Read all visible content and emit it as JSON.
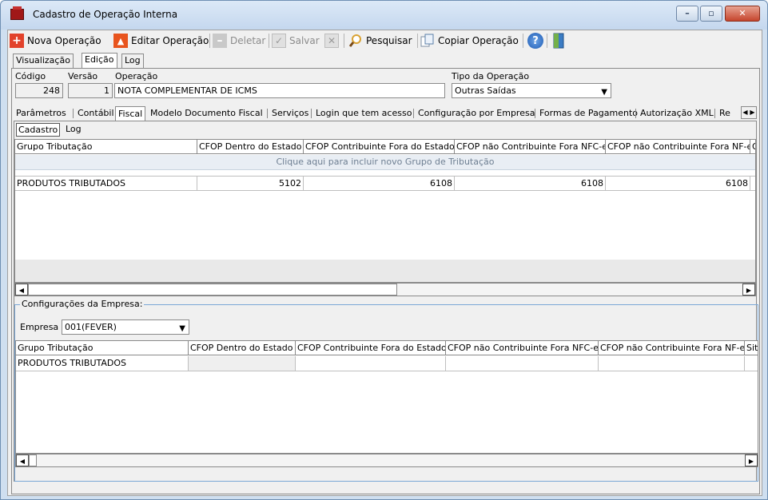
{
  "window": {
    "title": "Cadastro de Operação Interna",
    "minimize": "–",
    "maximize": "▫",
    "close": "✕"
  },
  "toolbar": {
    "new_op": "Nova Operação",
    "edit_op": "Editar Operação",
    "delete": "Deletar",
    "save": "Salvar",
    "search": "Pesquisar",
    "copy_op": "Copiar Operação"
  },
  "main_tabs": [
    "Visualização",
    "Edição",
    "Log"
  ],
  "form": {
    "codigo_label": "Código",
    "codigo": "248",
    "versao_label": "Versão",
    "versao": "1",
    "operacao_label": "Operação",
    "operacao": "NOTA COMPLEMENTAR DE ICMS",
    "tipo_label": "Tipo da Operação",
    "tipo": "Outras Saídas"
  },
  "sub_tabs": [
    "Parâmetros",
    "Contábil",
    "Fiscal",
    "Modelo Documento Fiscal",
    "Serviços",
    "Login que tem acesso",
    "Configuração por Empresa",
    "Formas de Pagamento",
    "Autorização XML",
    "Re"
  ],
  "inner_tabs": [
    "Cadastro",
    "Log"
  ],
  "grid1": {
    "headers": [
      "Grupo Tributação",
      "CFOP Dentro do Estado",
      "CFOP Contribuinte Fora do Estado",
      "CFOP não Contribuinte Fora NFC-e",
      "CFOP não Contribuinte Fora NF-e",
      "Ob"
    ],
    "new_row_hint": "Clique aqui para incluir novo Grupo de Tributação",
    "rows": [
      [
        "PRODUTOS TRIBUTADOS",
        "5102",
        "6108",
        "6108",
        "6108",
        ""
      ]
    ]
  },
  "empresa_group": {
    "title": "Configurações da Empresa:",
    "empresa_label": "Empresa",
    "empresa": "001(FEVER)"
  },
  "grid2": {
    "headers": [
      "Grupo Tributação",
      "CFOP Dentro do Estado",
      "CFOP Contribuinte Fora do Estado",
      "CFOP não Contribuinte Fora NFC-e",
      "CFOP não Contribuinte Fora NF-e",
      "Sit."
    ],
    "rows": [
      [
        "PRODUTOS TRIBUTADOS",
        "",
        "",
        "",
        "",
        ""
      ]
    ]
  },
  "icons": {
    "app": "red-briefcase",
    "new": "plus-icon",
    "edit": "up-arrow-icon",
    "delete": "minus-icon",
    "save": "check-icon",
    "cancel": "x-icon",
    "search": "magnifier-icon",
    "copy": "copy-icon",
    "help": "help-icon",
    "exit": "door-icon"
  },
  "colors": {
    "accent": "#3a6fb0",
    "new_icon": "#e2422b",
    "edit_icon": "#e8541e",
    "groupbox_border": "#7aa7d6"
  }
}
